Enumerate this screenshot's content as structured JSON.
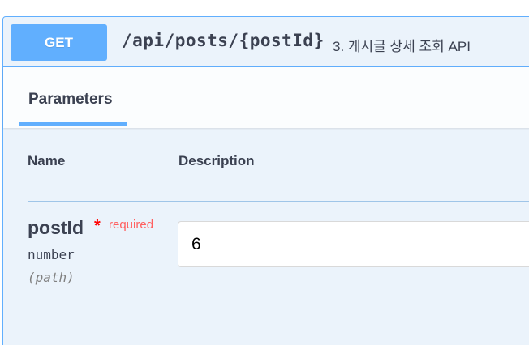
{
  "operation": {
    "method": "GET",
    "path": "/api/posts/{postId}",
    "summary": "3. 게시글 상세 조회 API"
  },
  "tabs": [
    {
      "label": "Parameters",
      "active": true
    }
  ],
  "columns": {
    "name": "Name",
    "description": "Description"
  },
  "parameters": [
    {
      "name": "postId",
      "required_marker": "*",
      "required_label": "required",
      "type": "number",
      "location": "(path)",
      "value": "6"
    }
  ],
  "colors": {
    "method_get": "#61affe",
    "block_background": "#ebf3fb",
    "text": "#3b4151",
    "required": "#ff0000"
  }
}
